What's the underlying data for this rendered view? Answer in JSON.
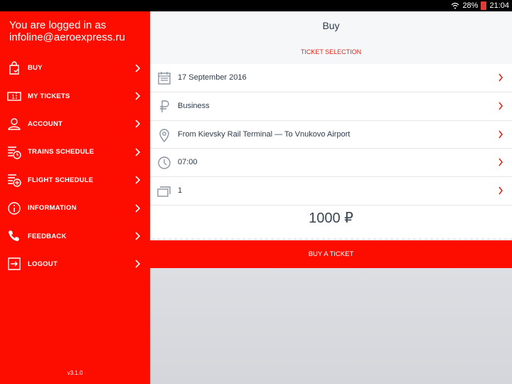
{
  "status": {
    "battery": "28%",
    "time": "21:04"
  },
  "sidebar": {
    "login_text": "You are logged in as infoline@aeroexpress.ru",
    "items": [
      {
        "label": "BUY",
        "icon": "bag-icon"
      },
      {
        "label": "MY TICKETS",
        "icon": "ticket-icon"
      },
      {
        "label": "ACCOUNT",
        "icon": "person-icon"
      },
      {
        "label": "TRAINS SCHEDULE",
        "icon": "train-schedule-icon"
      },
      {
        "label": "FLIGHT SCHEDULE",
        "icon": "flight-schedule-icon"
      },
      {
        "label": "INFORMATION",
        "icon": "info-icon"
      },
      {
        "label": "FEEDBACK",
        "icon": "phone-icon"
      },
      {
        "label": "LOGOUT",
        "icon": "logout-icon"
      }
    ],
    "version": "v3.1.0"
  },
  "main": {
    "title": "Buy",
    "section": "TICKET SELECTION",
    "rows": [
      {
        "text": "17 September 2016",
        "icon": "calendar-icon"
      },
      {
        "text": "Business",
        "icon": "ruble-icon"
      },
      {
        "text": "From Kievsky Rail Terminal — To Vnukovo Airport",
        "icon": "location-icon"
      },
      {
        "text": "07:00",
        "icon": "clock-icon"
      },
      {
        "text": "1",
        "icon": "tickets-count-icon"
      }
    ],
    "price": "1000 ₽",
    "buy_label": "BUY A TICKET"
  },
  "colors": {
    "accent": "#fc0d00",
    "text": "#2f3b4a"
  }
}
